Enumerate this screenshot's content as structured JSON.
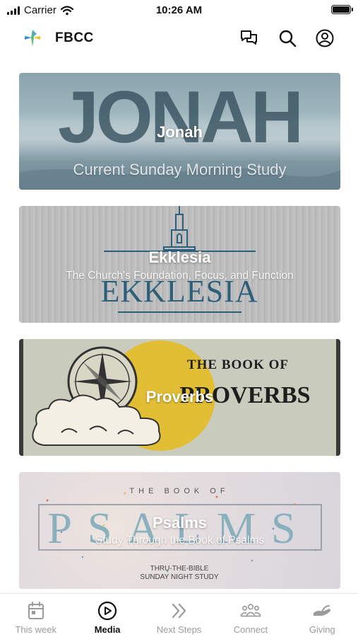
{
  "status_bar": {
    "carrier": "Carrier",
    "time": "10:26 AM"
  },
  "header": {
    "title": "FBCC"
  },
  "cards": [
    {
      "title": "Jonah",
      "subtitle": "Current Sunday Morning Study",
      "art_text": "JONAH"
    },
    {
      "title": "Ekklesia",
      "subtitle": "The Church's Foundation, Focus, and Function",
      "art_text": "EKKLESIA"
    },
    {
      "title": "Proverbs",
      "subtitle": "",
      "art_line1": "THE BOOK OF",
      "art_line2": "PROVERBS"
    },
    {
      "title": "Psalms",
      "subtitle": "Study Through the Book of Psalms",
      "art_top": "THE BOOK OF",
      "art_text": "PSALMS",
      "art_bottom1": "THRU-THE-BIBLE",
      "art_bottom2": "SUNDAY NIGHT STUDY"
    }
  ],
  "tabs": [
    {
      "label": "This week",
      "icon": "calendar-icon",
      "active": false
    },
    {
      "label": "Media",
      "icon": "play-circle-icon",
      "active": true
    },
    {
      "label": "Next Steps",
      "icon": "double-chevron-icon",
      "active": false
    },
    {
      "label": "Connect",
      "icon": "people-icon",
      "active": false
    },
    {
      "label": "Giving",
      "icon": "giving-hand-icon",
      "active": false
    }
  ],
  "colors": {
    "accent": "#111111",
    "inactive": "#9b9b9b",
    "logo_blue": "#2f8fd8",
    "logo_yellow": "#f2c230",
    "logo_green": "#5cc16a"
  }
}
